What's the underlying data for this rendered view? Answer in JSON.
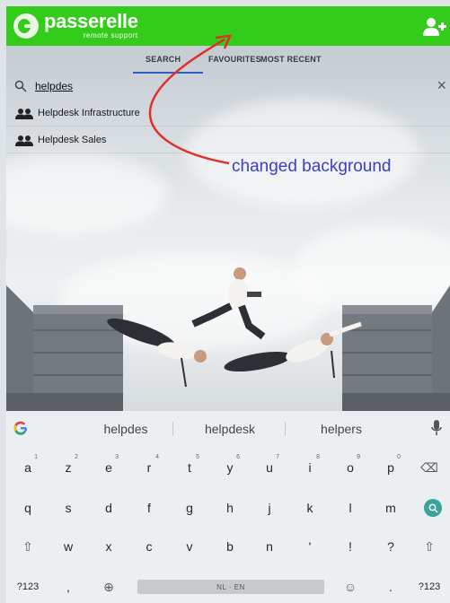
{
  "header": {
    "app_name": "passerelle",
    "app_subtitle": "remote support",
    "add_user_icon": "add-user-icon",
    "brand_color": "#33cc1a"
  },
  "tabs": [
    {
      "label": "SEARCH",
      "active": true
    },
    {
      "label": "FAVOURITES",
      "active": false
    },
    {
      "label": "MOST RECENT",
      "active": false
    }
  ],
  "search": {
    "value": "helpdes",
    "placeholder": "",
    "clear_label": "×"
  },
  "results": [
    {
      "label": "Helpdesk Infrastructure",
      "icon": "group-icon"
    },
    {
      "label": "Helpdesk Sales",
      "icon": "group-icon"
    }
  ],
  "annotation": {
    "text": "changed background",
    "color": "#3c3ec4",
    "arrow_color": "#e0302a"
  },
  "keyboard": {
    "suggestions": [
      "helpdes",
      "helpdesk",
      "helpers"
    ],
    "row1": [
      {
        "key": "a",
        "hint": "1"
      },
      {
        "key": "z",
        "hint": "2"
      },
      {
        "key": "e",
        "hint": "3"
      },
      {
        "key": "r",
        "hint": "4"
      },
      {
        "key": "t",
        "hint": "5"
      },
      {
        "key": "y",
        "hint": "6"
      },
      {
        "key": "u",
        "hint": "7"
      },
      {
        "key": "i",
        "hint": "8"
      },
      {
        "key": "o",
        "hint": "9"
      },
      {
        "key": "p",
        "hint": "0"
      },
      {
        "key": "⌫",
        "hint": ""
      }
    ],
    "row2": [
      "q",
      "s",
      "d",
      "f",
      "g",
      "h",
      "j",
      "k",
      "l",
      "m"
    ],
    "row3": [
      "⇧",
      "w",
      "x",
      "c",
      "v",
      "b",
      "n",
      "'",
      "!",
      "?",
      "⇧"
    ],
    "row4": {
      "symbols": "?123",
      "comma": ",",
      "globe": "⊕",
      "space_label": "NL · EN",
      "emoji": "☺",
      "period": ".",
      "symbols_right": "?123"
    },
    "accent_color": "#3aa39b"
  }
}
